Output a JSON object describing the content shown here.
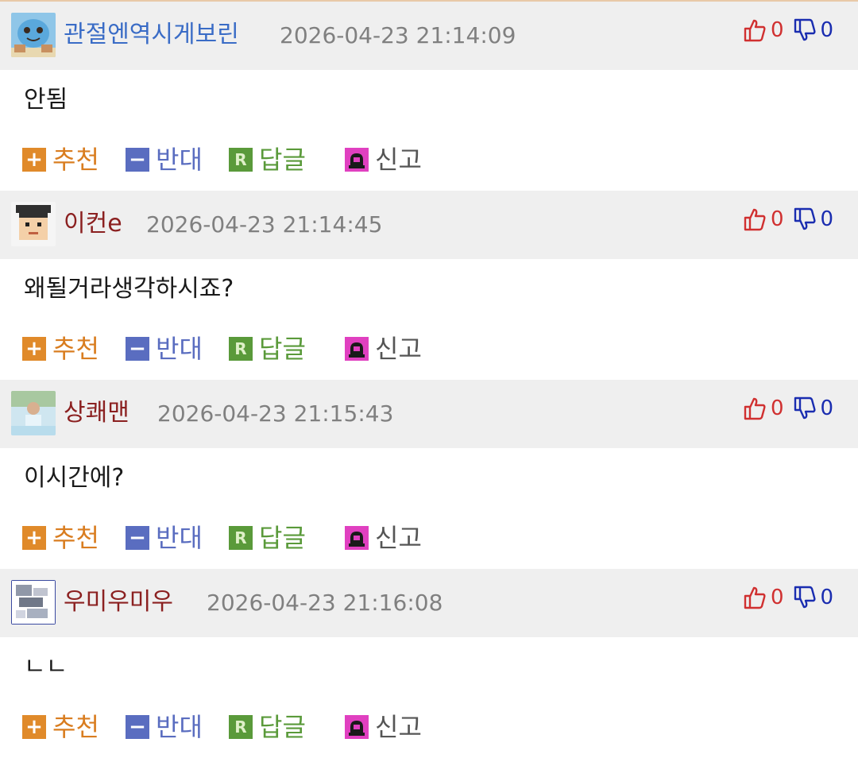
{
  "comments": [
    {
      "nick": "관절엔역시게보린",
      "timestamp": "2026-04-23 21:14:09",
      "up_count": "0",
      "down_count": "0",
      "body": "안됨",
      "avatar": "squirtle-avatar"
    },
    {
      "nick": "이컨e",
      "timestamp": "2026-04-23 21:14:45",
      "up_count": "0",
      "down_count": "0",
      "body": "왜될거라생각하시죠?",
      "avatar": "pixel-face-avatar"
    },
    {
      "nick": "상쾌맨",
      "timestamp": "2026-04-23 21:15:43",
      "up_count": "0",
      "down_count": "0",
      "body": "이시간에?",
      "avatar": "photo-avatar"
    },
    {
      "nick": "우미우미우",
      "timestamp": "2026-04-23 21:16:08",
      "up_count": "0",
      "down_count": "0",
      "body": "ㄴㄴ",
      "avatar": "glitch-avatar"
    }
  ],
  "actions": {
    "recommend": "추천",
    "oppose": "반대",
    "reply": "답글",
    "report": "신고"
  },
  "icon_labels": {
    "plus": "+",
    "minus": "−",
    "reply": "R"
  },
  "colors": {
    "header_bg": "#efefef",
    "nick_blue": "#3a6cc6",
    "nick_brown": "#8b2020",
    "timestamp": "#808080",
    "up": "#d03030",
    "down": "#1a2db0",
    "recommend": "#d97d20",
    "oppose": "#5a6dc0",
    "reply": "#5a9a3a",
    "report_icon": "#e040c0"
  }
}
